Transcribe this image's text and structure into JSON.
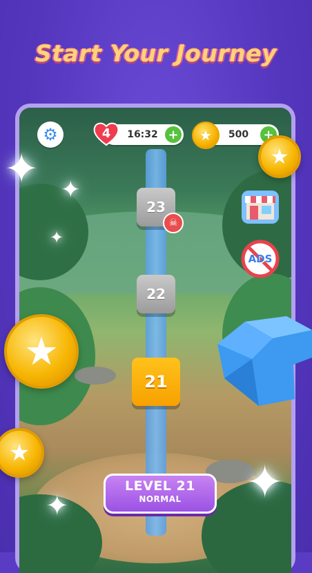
{
  "headline": "Start Your Journey",
  "hud": {
    "lives_count": "4",
    "lives_timer": "16:32",
    "coins": "500",
    "plus_label": "+"
  },
  "level_tiles": [
    {
      "number": "23",
      "state": "locked-boss"
    },
    {
      "number": "22",
      "state": "locked"
    },
    {
      "number": "21",
      "state": "current"
    }
  ],
  "side_buttons": {
    "shop_icon": "shop-icon",
    "no_ads_label": "ADS"
  },
  "level_button": {
    "title": "LEVEL 21",
    "difficulty": "NORMAL"
  },
  "colors": {
    "background": "#5a3cc4",
    "headline": "#ffd27a",
    "current_tile": "#f7a100",
    "level_button": "#9b52e4",
    "path": "#6aaeea"
  }
}
